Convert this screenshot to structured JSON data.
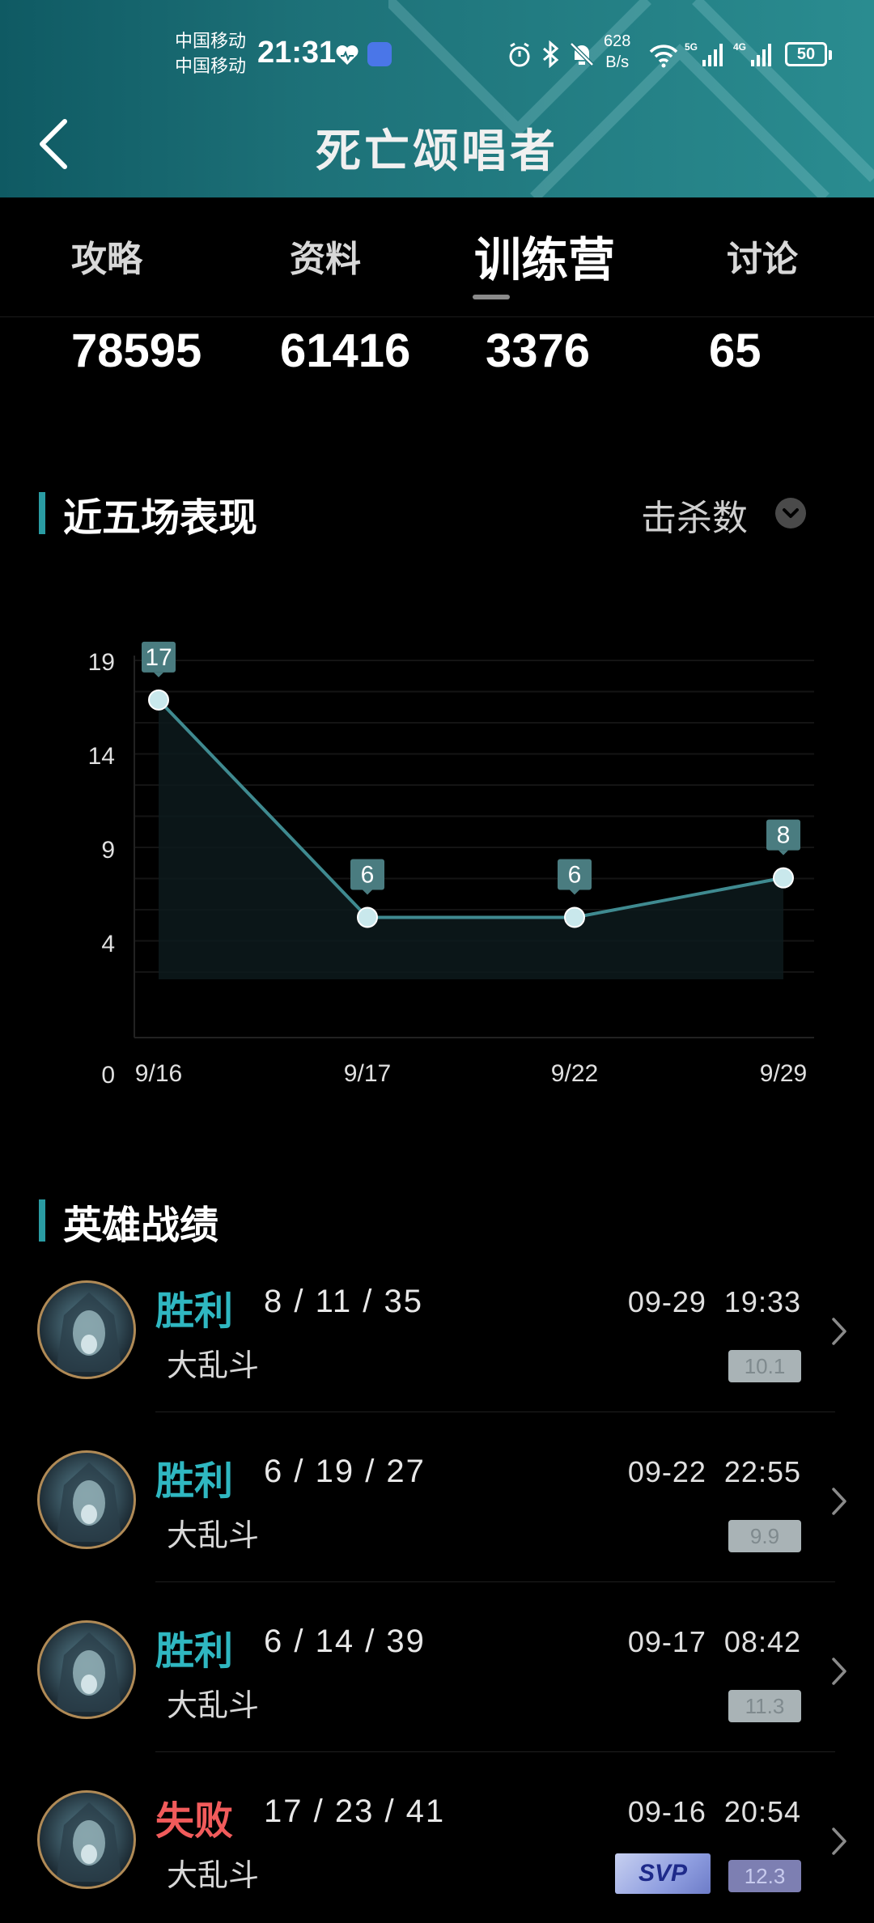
{
  "status_bar": {
    "carrier_1": "中国移动",
    "carrier_2": "中国移动",
    "time": "21:31",
    "net_speed_value": "628",
    "net_speed_unit": "B/s",
    "battery": "50"
  },
  "header": {
    "title": "死亡颂唱者"
  },
  "tabs": [
    {
      "label": "攻略"
    },
    {
      "label": "资料"
    },
    {
      "label": "训练营"
    },
    {
      "label": "讨论"
    }
  ],
  "active_tab": "训练营",
  "stats": [
    "78595",
    "61416",
    "3376",
    "65"
  ],
  "performance": {
    "title": "近五场表现",
    "metric": "击杀数"
  },
  "chart_data": {
    "type": "line",
    "categories": [
      "9/16",
      "9/17",
      "9/22",
      "9/29"
    ],
    "series": [
      {
        "values": [
          17,
          6,
          6,
          8
        ]
      }
    ],
    "yticks": [
      0,
      4,
      9,
      14,
      19
    ],
    "ylim": [
      0,
      19
    ],
    "grid": true,
    "data_labels": true,
    "line_color": "#3f8a90",
    "point_color": "#c9e8ec"
  },
  "records_section": {
    "title": "英雄战绩"
  },
  "records": [
    {
      "result": "胜利",
      "outcome": "win",
      "kda": "8 / 11 / 35",
      "date": "09-29",
      "clock": "19:33",
      "mode": "大乱斗",
      "score": "10.1",
      "svp": false
    },
    {
      "result": "胜利",
      "outcome": "win",
      "kda": "6 / 19 / 27",
      "date": "09-22",
      "clock": "22:55",
      "mode": "大乱斗",
      "score": "9.9",
      "svp": false
    },
    {
      "result": "胜利",
      "outcome": "win",
      "kda": "6 / 14 / 39",
      "date": "09-17",
      "clock": "08:42",
      "mode": "大乱斗",
      "score": "11.3",
      "svp": false
    },
    {
      "result": "失败",
      "outcome": "loss",
      "kda": "17 / 23 / 41",
      "date": "09-16",
      "clock": "20:54",
      "mode": "大乱斗",
      "score": "12.3",
      "svp": true,
      "svp_label": "SVP"
    }
  ],
  "colors": {
    "accent": "#2a9ca3",
    "win": "#2fb7c1",
    "loss": "#f15b5b"
  }
}
